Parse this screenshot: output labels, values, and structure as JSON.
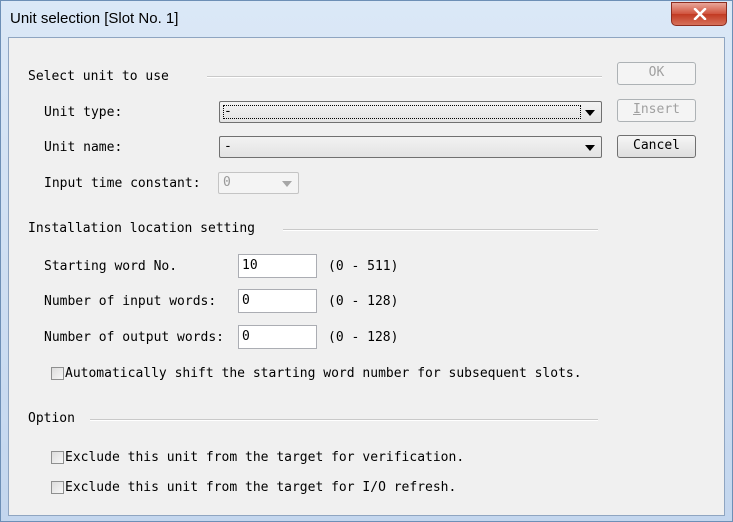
{
  "window": {
    "title": "Unit selection [Slot No. 1]"
  },
  "select_unit": {
    "heading": "Select unit to use",
    "unit_type_label": "Unit type:",
    "unit_type_value": "-",
    "unit_name_label": "Unit name:",
    "unit_name_value": "-",
    "input_time_constant_label": "Input time constant:",
    "input_time_constant_value": "0"
  },
  "buttons": {
    "ok": "OK",
    "insert_accel": "I",
    "insert_rest": "nsert",
    "cancel": "Cancel"
  },
  "installation": {
    "heading": "Installation location setting",
    "starting_word_label": "Starting word No.",
    "starting_word_value": "10",
    "starting_word_range": "(0 - 511)",
    "input_words_label": "Number of input words:",
    "input_words_value": "0",
    "input_words_range": "(0 - 128)",
    "output_words_label": "Number of output words:",
    "output_words_value": "0",
    "output_words_range": "(0 - 128)",
    "auto_shift_label": "Automatically shift the starting word number for subsequent slots."
  },
  "option": {
    "heading": "Option",
    "exclude_verification_label": "Exclude this unit from the target for verification.",
    "exclude_io_refresh_label": "Exclude this unit from the target for I/O refresh."
  }
}
